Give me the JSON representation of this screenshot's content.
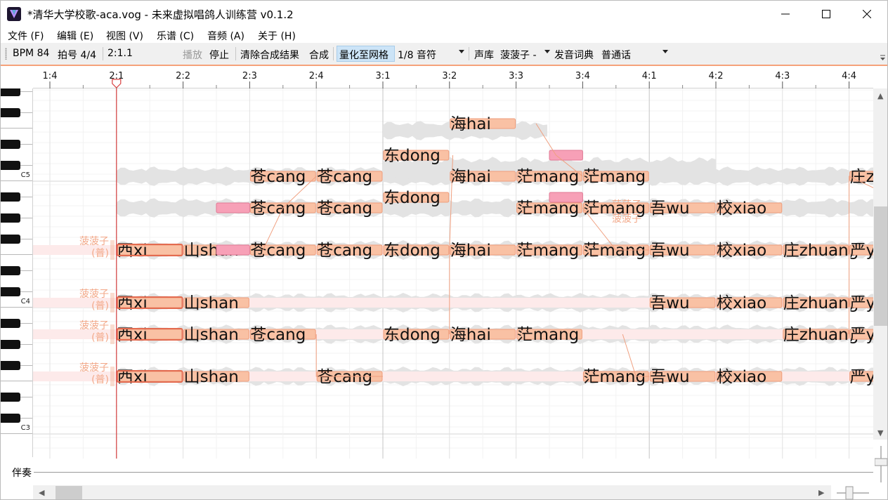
{
  "window": {
    "title": "*清华大学校歌-aca.vog - 未来虚拟唱鸽人训练营 v0.1.2"
  },
  "menu": [
    "文件 (F)",
    "编辑 (E)",
    "视图 (V)",
    "乐谱 (C)",
    "音频 (A)",
    "关于 (H)"
  ],
  "toolbar": {
    "bpm": "BPM 84",
    "time_sig": "拍号 4/4",
    "position": "2:1.1",
    "play": "播放",
    "stop": "停止",
    "clear_synth": "清除合成结果",
    "synth": "合成",
    "quantize": "量化至网格",
    "note_length": "1/8 音符",
    "voicebank_label": "声库",
    "voicebank": "菠菠子 -",
    "dictionary_label": "发音词典",
    "dictionary": "普通话"
  },
  "ruler": [
    "1:4",
    "2:1",
    "2:2",
    "2:3",
    "2:4",
    "3:1",
    "3:2",
    "3:3",
    "3:4",
    "4:1",
    "4:2",
    "4:3",
    "4:4"
  ],
  "keyboard": {
    "labels": [
      "C5",
      "C4",
      "C3"
    ]
  },
  "tracks": {
    "singer_label": "菠菠子",
    "singer_sub": "(普)"
  },
  "notes": [
    [
      "海hai"
    ],
    [
      "东dong"
    ],
    [
      "苍cang",
      "苍cang",
      "海hai",
      "茫mang",
      "茫mang",
      "庄zhuang"
    ],
    [
      "东dong"
    ],
    [
      "苍cang",
      "苍cang",
      "茫mang",
      "茫mang",
      "吾wu",
      "校xiao"
    ],
    [
      "西xi",
      "山shan",
      "苍cang",
      "苍cang",
      "东dong",
      "海hai",
      "茫mang",
      "茫mang",
      "吾wu",
      "校xiao",
      "庄zhuang",
      "严y"
    ],
    [
      "西xi",
      "山shan",
      "吾wu",
      "校xiao",
      "庄zhuang",
      "严y"
    ],
    [
      "西xi",
      "山shan",
      "苍cang",
      "东dong",
      "海hai",
      "茫mang",
      "庄zhuang",
      "严y"
    ],
    [
      "西xi",
      "山shan",
      "苍cang",
      "茫mang",
      "吾wu",
      "校xiao",
      "严y"
    ]
  ],
  "accompaniment": {
    "label": "伴奏"
  },
  "colors": {
    "note_fill": "#f9c1a4",
    "note_stroke": "#ef9d7b",
    "selected_note": "#f7a0b7",
    "playhead": "#d84040",
    "accent_line": "#f5a27a",
    "toggle_bg": "#cce4f7"
  }
}
